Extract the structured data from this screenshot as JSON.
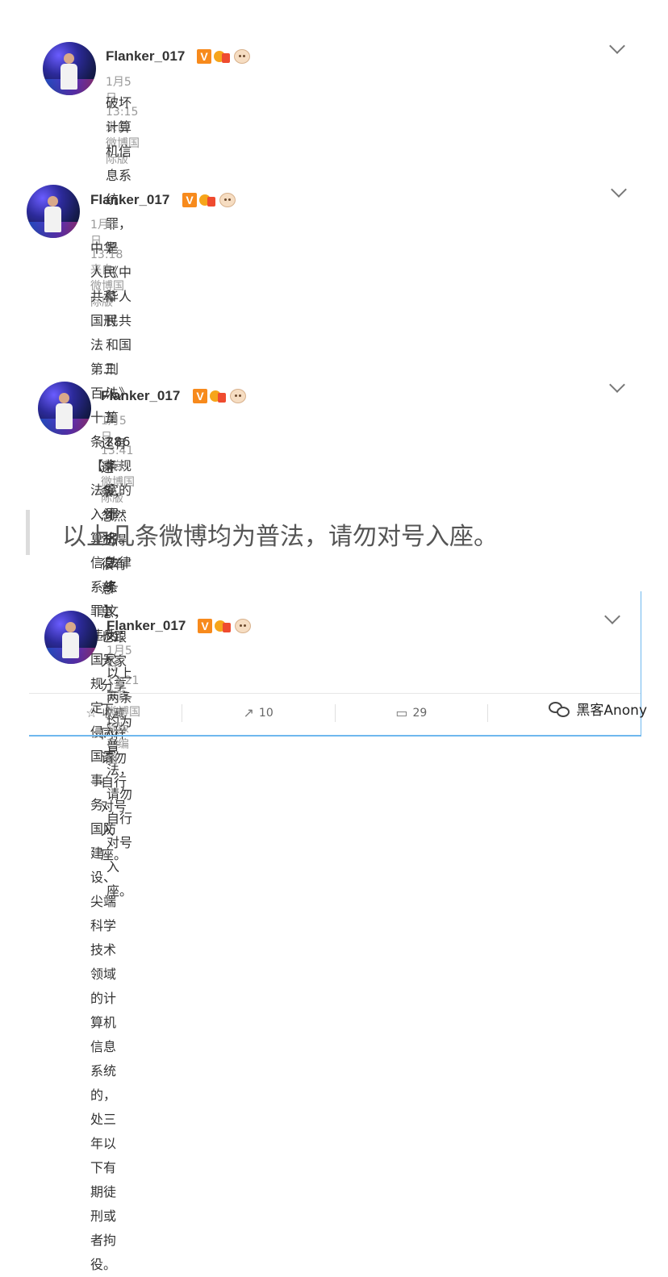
{
  "posts": [
    {
      "username": "Flanker_017",
      "verified_badge": "V",
      "date": "1月5日",
      "time": "13:15",
      "source": "来自 微博国际版",
      "edited": "",
      "lines": [
        "破坏计算机信息系统罪，是《中华人民共和国刑法》第286条规定的罪名。法律条",
        "文为："
      ]
    },
    {
      "username": "Flanker_017",
      "verified_badge": "V",
      "date": "1月5日",
      "time": "13:18",
      "source": "来自 微博国际版",
      "edited": "",
      "lines": [
        "中华人民共和国刑法 第二百八十五条　【非法侵入计算机信息系统罪】违反国家",
        "规定，侵入国家事务、国防建设、尖端科学技术领域的计算机信息系统的，处三",
        "年以下有期徒刑或者拘役。"
      ]
    },
    {
      "username": "Flanker_017",
      "verified_badge": "V",
      "date": "1月5日",
      "time": "13:41",
      "source": "来自 微博国际版",
      "edited": "",
      "lines": [
        "还有这条，忽然觉得很有意思，也跟大家分享下，同样请勿自行对号入座。"
      ]
    },
    {
      "username": "Flanker_017",
      "verified_badge": "V",
      "date": "1月5日",
      "time": "13:21",
      "source": "来自 微博国际版",
      "edited": "已编辑",
      "lines": [
        "以上两条均为普法，请勿自行对号入座。"
      ]
    }
  ],
  "quote": "以上几条微博均为普法，请勿对号入座。",
  "footer": {
    "favorite_label": "收藏",
    "repost_count": "10",
    "comment_count": "29"
  },
  "watermark": "黑客Anony",
  "icons": {
    "favorite": "star-icon",
    "repost": "share-icon",
    "comment": "comment-icon",
    "expand": "chevron-down-icon",
    "wechat": "wechat-icon"
  },
  "colors": {
    "vip_badge": "#f78a1c",
    "meta_gray": "#999999",
    "card_border": "#6fb8ee"
  }
}
